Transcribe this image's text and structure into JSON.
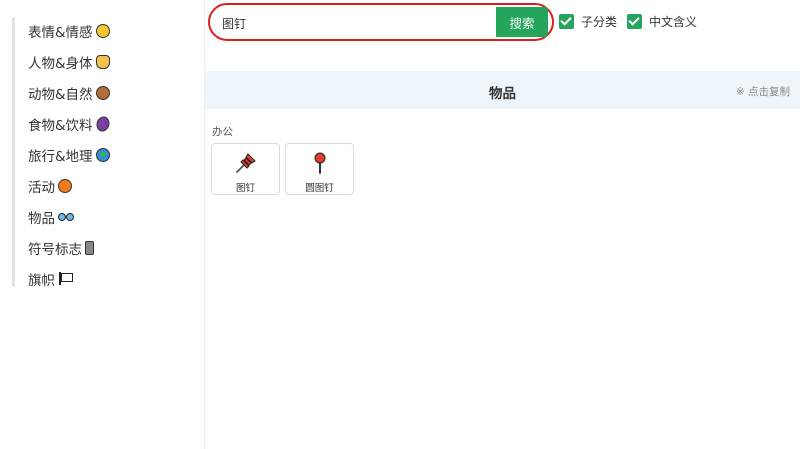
{
  "sidebar": {
    "items": [
      {
        "label": "表情&情感",
        "icon": "smiling-face-icon"
      },
      {
        "label": "人物&身体",
        "icon": "clapping-hands-icon"
      },
      {
        "label": "动物&自然",
        "icon": "monkey-face-icon"
      },
      {
        "label": "食物&饮料",
        "icon": "eggplant-icon"
      },
      {
        "label": "旅行&地理",
        "icon": "globe-icon"
      },
      {
        "label": "活动",
        "icon": "jack-o-lantern-icon"
      },
      {
        "label": "物品",
        "icon": "glasses-icon"
      },
      {
        "label": "符号标志",
        "icon": "mobile-phone-icon"
      },
      {
        "label": "旗帜",
        "icon": "white-flag-icon"
      }
    ]
  },
  "search": {
    "value": "图钉",
    "button_label": "搜索"
  },
  "options": {
    "subcategory_label": "子分类",
    "subcategory_checked": true,
    "chinese_meaning_label": "中文含义",
    "chinese_meaning_checked": true
  },
  "section": {
    "title": "物品",
    "copy_hint": "※ 点击复制",
    "subcategory": "办公",
    "results": [
      {
        "label": "图钉",
        "icon": "pushpin-icon"
      },
      {
        "label": "圆图钉",
        "icon": "round-pushpin-icon"
      }
    ]
  },
  "colors": {
    "accent_green": "#23a55b",
    "highlight_red": "#d9201e",
    "header_bg": "#eef6fc"
  }
}
